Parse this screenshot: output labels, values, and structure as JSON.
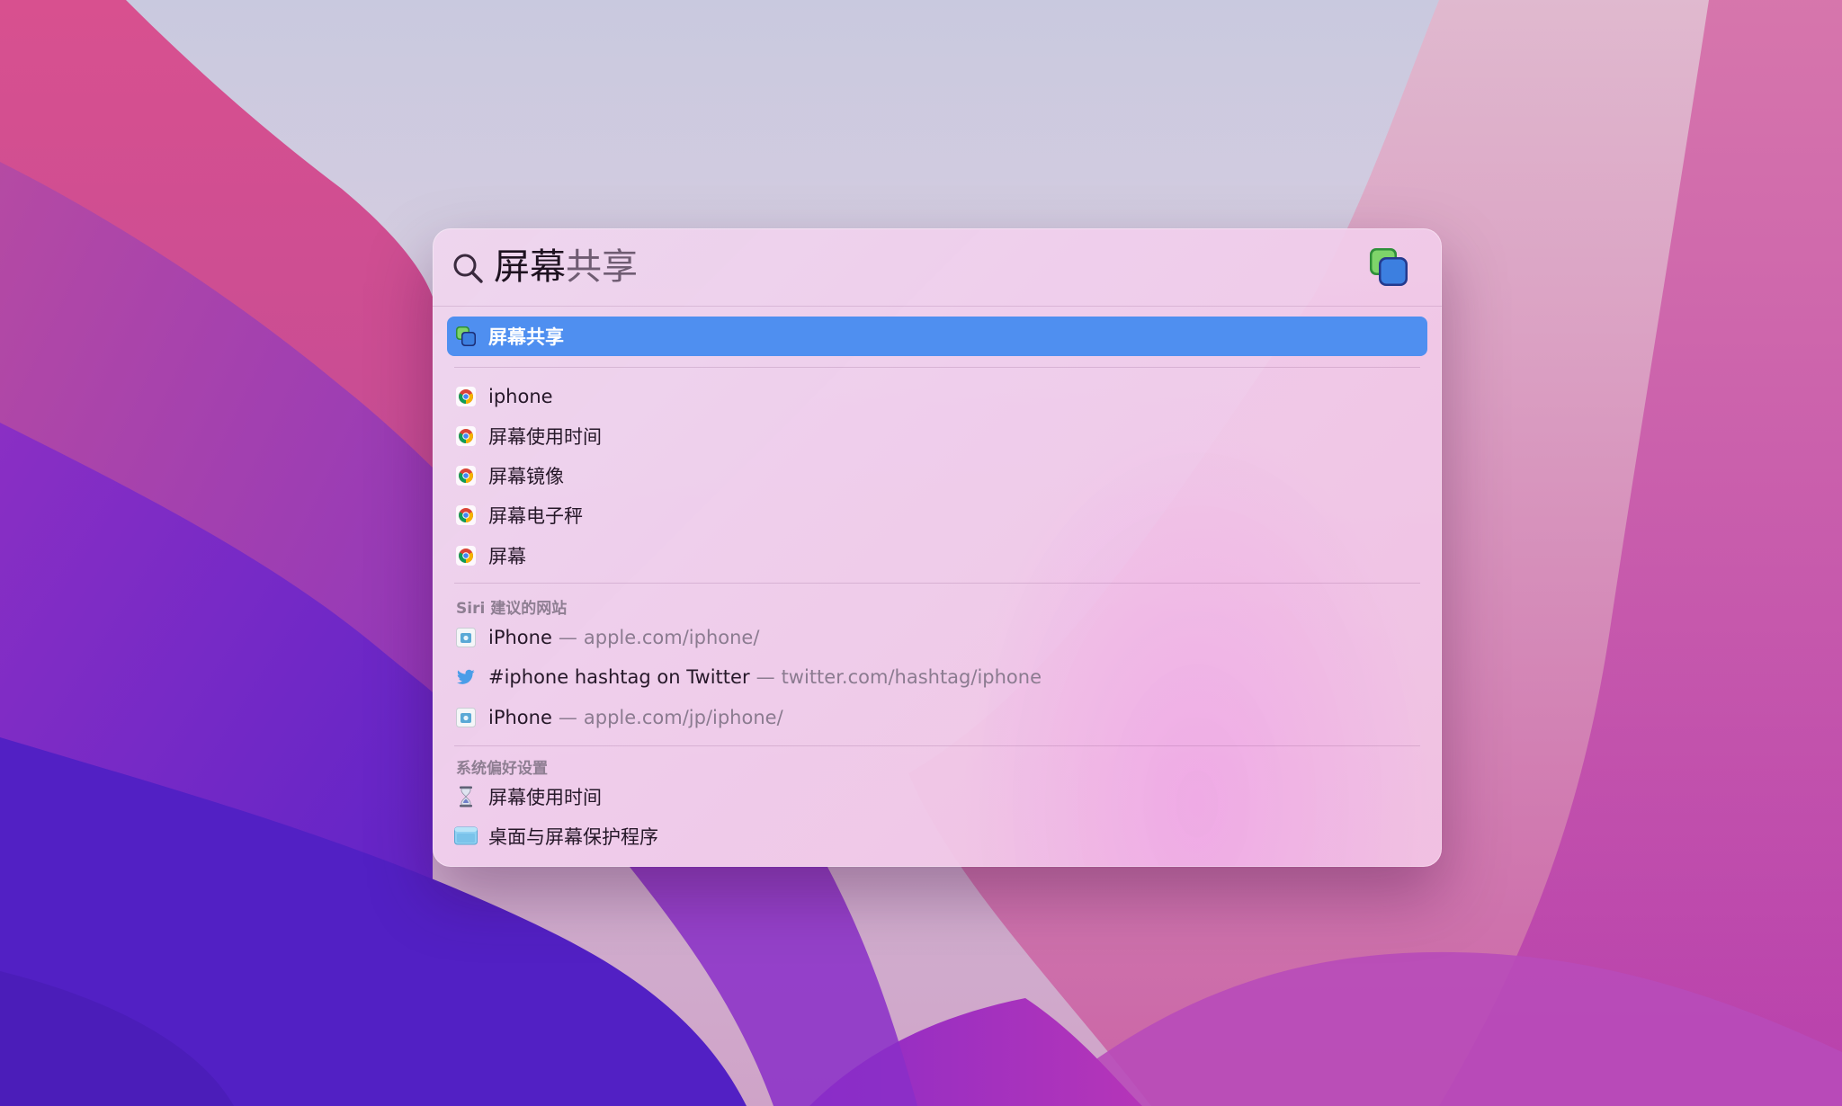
{
  "search": {
    "typed": "屏幕",
    "completion": "共享",
    "top_app_icon": "screen-sharing-icon"
  },
  "top_hit": {
    "label": "屏幕共享",
    "icon": "screen-sharing-icon"
  },
  "suggestions": [
    {
      "label": "iphone",
      "icon": "chrome-icon"
    },
    {
      "label": "屏幕使用时间",
      "icon": "chrome-icon"
    },
    {
      "label": "屏幕镜像",
      "icon": "chrome-icon"
    },
    {
      "label": "屏幕电子秤",
      "icon": "chrome-icon"
    },
    {
      "label": "屏幕",
      "icon": "chrome-icon"
    }
  ],
  "siri_section": {
    "title": "Siri 建议的网站",
    "items": [
      {
        "label": "iPhone",
        "separator": "—",
        "url": "apple.com/iphone/",
        "icon": "apple-site-icon"
      },
      {
        "label": "#iphone hashtag on Twitter",
        "separator": "—",
        "url": "twitter.com/hashtag/iphone",
        "icon": "twitter-bird-icon"
      },
      {
        "label": "iPhone",
        "separator": "—",
        "url": "apple.com/jp/iphone/",
        "icon": "apple-site-icon"
      }
    ]
  },
  "prefs_section": {
    "title": "系统偏好设置",
    "items": [
      {
        "label": "屏幕使用时间",
        "icon": "hourglass-icon"
      },
      {
        "label": "桌面与屏幕保护程序",
        "icon": "desktop-screensaver-icon"
      }
    ]
  },
  "colors": {
    "selection": "#4f8ff0",
    "wallpaper_primary": "#7a2fd0",
    "wallpaper_secondary": "#d84a9c"
  }
}
